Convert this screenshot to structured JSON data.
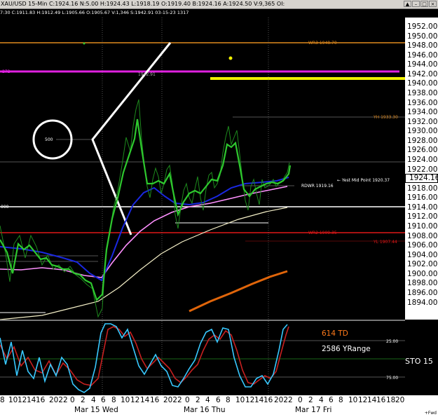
{
  "window": {
    "title": "XAU/USD  15-Min  C:1924.16  N:5.00  H:1924.43  L:1918.19  O:1919.40  B:1924.16  A:1924.50  V:9,365  OI:",
    "controls": [
      "▲",
      "–",
      "□",
      "×"
    ]
  },
  "info_line": "7:30  C:1911.83  H:1912.49  L:1905.66  O:1905.67  V:1,346  S:1942.91  03-15-23  1317",
  "price_axis": {
    "ticks": [
      "1952.00",
      "1950.00",
      "1948.00",
      "1946.00",
      "1944.00",
      "1942.00",
      "1940.00",
      "1938.00",
      "1936.00",
      "1934.00",
      "1932.00",
      "1930.00",
      "1928.00",
      "1926.00",
      "1924.00",
      "1922.00",
      "1920.00",
      "1918.00",
      "1916.00",
      "1914.00",
      "1912.00",
      "1910.00",
      "1908.00",
      "1906.00",
      "1904.00",
      "1902.00",
      "1900.00",
      "1898.00",
      "1896.00",
      "1894.00"
    ],
    "current_price": "1924.16"
  },
  "levels": {
    "wr3": "WR3 1948.70",
    "level_272": "272",
    "price_1942": "1942.91",
    "yh": "YH 1933.30",
    "label_500": "500",
    "yest_mid": "← Yest Mid Point 1920.37",
    "rdwr": "RDWR 1919.16",
    "label_000": "000",
    "wr2": "WR2 1909.35",
    "yl": "YL 1907.44"
  },
  "stoch": {
    "td_label": "614 TD",
    "yrange_label": "2586 YRange",
    "indicator": "STO  15",
    "axis_25": "25.00",
    "axis_75": "75.00"
  },
  "date_axis": {
    "ticks": [
      "8",
      "10",
      "12",
      "14",
      "16",
      "2022",
      "0",
      "2",
      "4",
      "6",
      "8",
      "10",
      "12",
      "14",
      "16",
      "2022",
      "0",
      "2",
      "4",
      "6",
      "8",
      "10",
      "12",
      "14",
      "16",
      "2022",
      "0",
      "2",
      "4",
      "6",
      "8",
      "10",
      "12",
      "14",
      "16",
      "18",
      "20"
    ],
    "days": [
      "Mar 15 Wed",
      "Mar 16 Thu",
      "Mar 17 Fri"
    ],
    "corner": "+Fwd"
  },
  "colors": {
    "orange": "#e08a1e",
    "magenta": "#e020e0",
    "yellow": "#f0f000",
    "red": "#e01818",
    "green": "#2ec82e",
    "blue": "#1a28e0",
    "pink": "#ff90ff",
    "cream": "#f5f0c8",
    "dark_orange": "#e0650a",
    "white": "#ffffff",
    "cyan": "#38c8ff",
    "dark_red": "#b01010",
    "td_color": "#ff7a1a"
  }
}
